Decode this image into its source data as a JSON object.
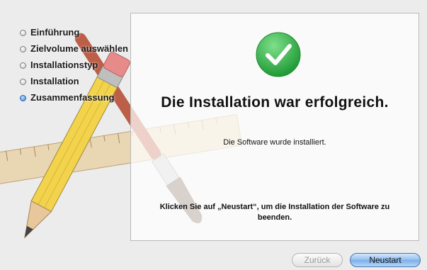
{
  "sidebar": {
    "steps": [
      {
        "label": "Einführung",
        "active": false
      },
      {
        "label": "Zielvolume auswählen",
        "active": false
      },
      {
        "label": "Installationstyp",
        "active": false
      },
      {
        "label": "Installation",
        "active": false
      },
      {
        "label": "Zusammenfassung",
        "active": true
      }
    ]
  },
  "main": {
    "status_icon": "checkmark-success-icon",
    "title": "Die Installation war erfolgreich.",
    "subtitle": "Die Software wurde installiert.",
    "hint": "Klicken Sie auf „Neustart“, um die Installation der Software zu beenden."
  },
  "buttons": {
    "back_label": "Zurück",
    "back_enabled": false,
    "restart_label": "Neustart",
    "restart_default": true
  },
  "colors": {
    "success": "#2fb84a",
    "active_step": "#3c82dc",
    "default_button": "#7aaee9"
  }
}
